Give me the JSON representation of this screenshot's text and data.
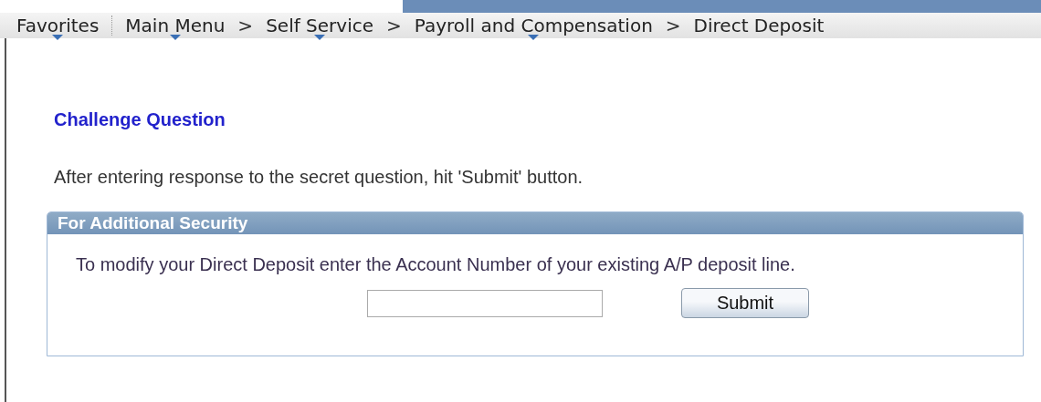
{
  "nav": [
    {
      "kind": "link",
      "text": "Favorites",
      "menu": true
    },
    {
      "kind": "divider"
    },
    {
      "kind": "link",
      "text": "Main Menu",
      "menu": true
    },
    {
      "kind": "separator",
      "text": ">"
    },
    {
      "kind": "link",
      "text": "Self Service",
      "menu": true
    },
    {
      "kind": "separator",
      "text": ">"
    },
    {
      "kind": "link",
      "text": "Payroll and Compensation",
      "menu": true
    },
    {
      "kind": "separator",
      "text": ">"
    },
    {
      "kind": "link",
      "text": "Direct Deposit",
      "menu": false
    }
  ],
  "heading": "Challenge Question",
  "instruction": "After entering response to the secret question, hit 'Submit' button.",
  "group": {
    "title": "For Additional Security",
    "text": "To modify your Direct Deposit enter the Account Number of your existing A/P deposit line.",
    "button": "Submit"
  }
}
